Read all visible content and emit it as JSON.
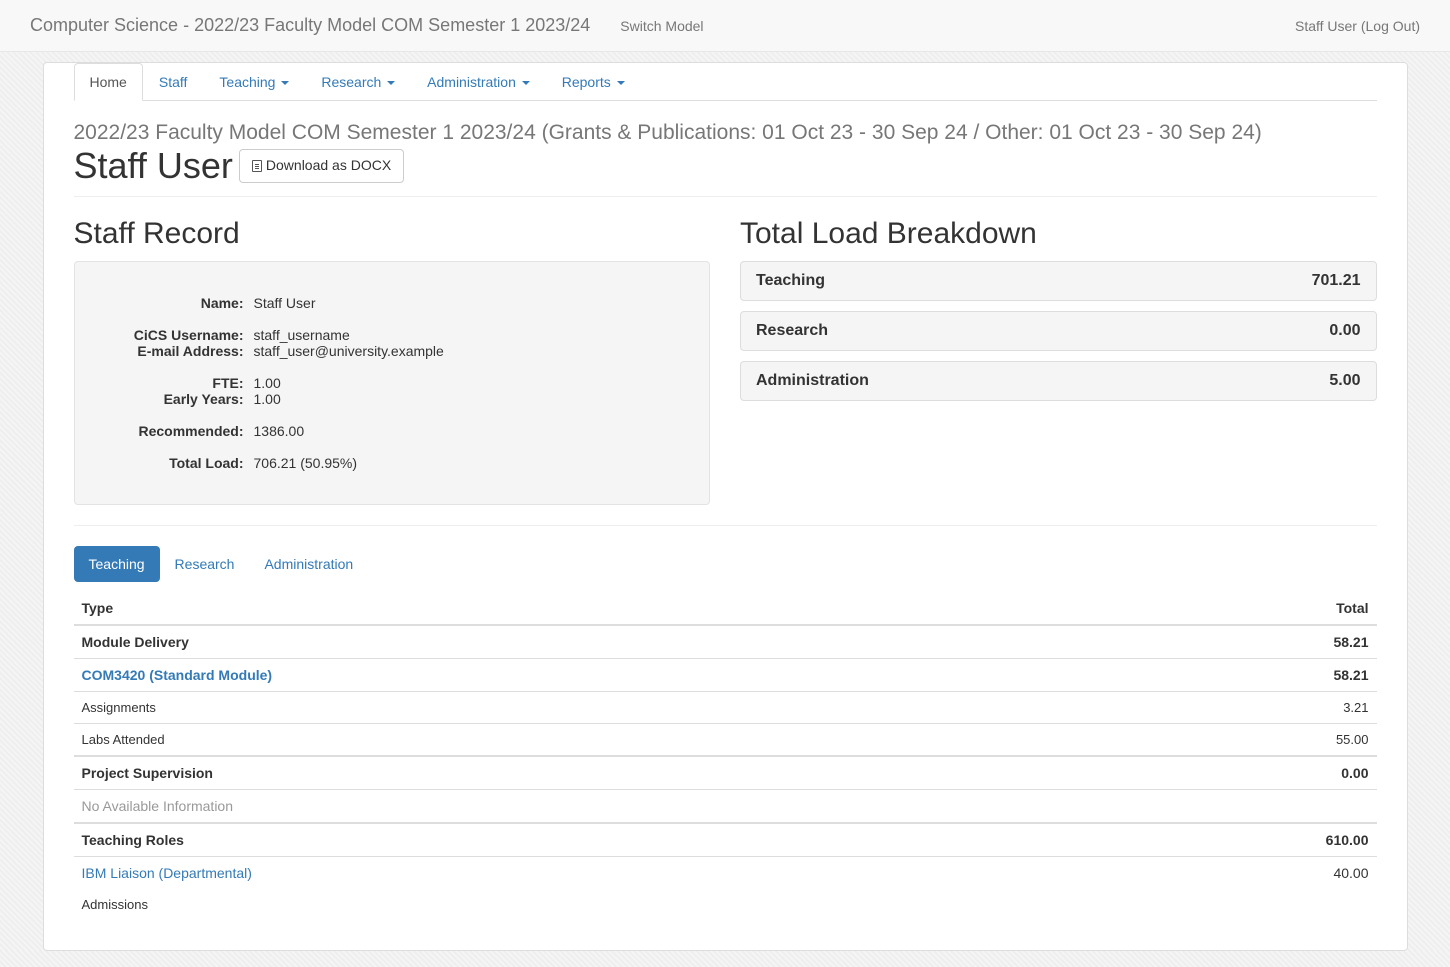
{
  "topbar": {
    "brand": "Computer Science - 2022/23 Faculty Model COM Semester 1 2023/24",
    "switch": "Switch Model",
    "user": "Staff User (Log Out)"
  },
  "nav": {
    "home": "Home",
    "staff": "Staff",
    "teaching": "Teaching",
    "research": "Research",
    "administration": "Administration",
    "reports": "Reports"
  },
  "subheading": "2022/23 Faculty Model COM Semester 1 2023/24 (Grants & Publications: 01 Oct 23 - 30 Sep 24 / Other: 01 Oct 23 - 30 Sep 24)",
  "page_title": "Staff User",
  "download_btn": "Download as DOCX",
  "staff_record": {
    "heading": "Staff Record",
    "labels": {
      "name": "Name:",
      "cics": "CiCS Username:",
      "email": "E-mail Address:",
      "fte": "FTE:",
      "early_years": "Early Years:",
      "recommended": "Recommended:",
      "total_load": "Total Load:"
    },
    "values": {
      "name": "Staff User",
      "cics": "staff_username",
      "email": "staff_user@university.example",
      "fte": "1.00",
      "early_years": "1.00",
      "recommended": "1386.00",
      "total_load": "706.21 (50.95%)"
    }
  },
  "load_breakdown": {
    "heading": "Total Load Breakdown",
    "teaching_label": "Teaching",
    "teaching_value": "701.21",
    "research_label": "Research",
    "research_value": "0.00",
    "admin_label": "Administration",
    "admin_value": "5.00"
  },
  "pills": {
    "teaching": "Teaching",
    "research": "Research",
    "administration": "Administration"
  },
  "table": {
    "head_type": "Type",
    "head_total": "Total",
    "module_delivery": "Module Delivery",
    "module_delivery_total": "58.21",
    "module_link": "COM3420 (Standard Module)",
    "module_link_total": "58.21",
    "assignments": "Assignments",
    "assignments_total": "3.21",
    "labs": "Labs Attended",
    "labs_total": "55.00",
    "project_supervision": "Project Supervision",
    "project_supervision_total": "0.00",
    "no_info": "No Available Information",
    "teaching_roles": "Teaching Roles",
    "teaching_roles_total": "610.00",
    "ibm": "IBM Liaison (Departmental)",
    "ibm_total": "40.00",
    "admissions": "Admissions"
  }
}
